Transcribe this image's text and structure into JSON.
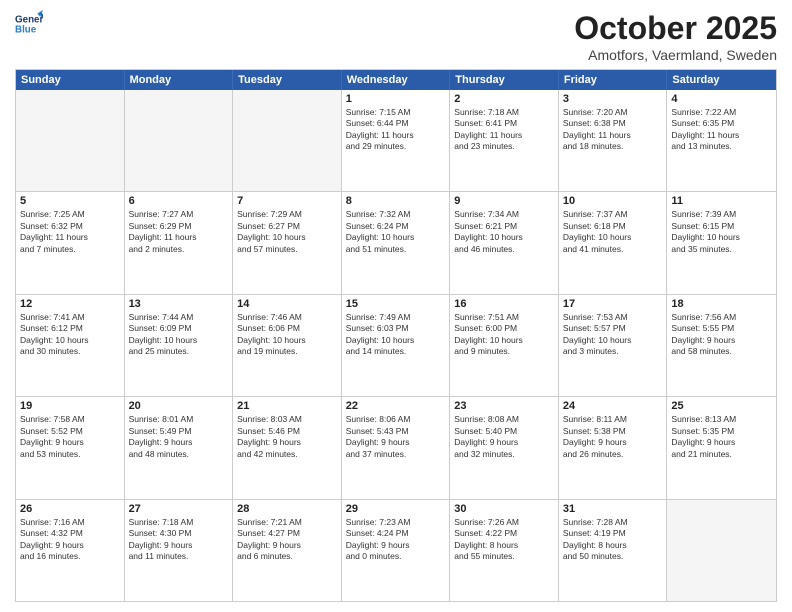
{
  "header": {
    "logo": {
      "line1": "General",
      "line2": "Blue"
    },
    "title": "October 2025",
    "location": "Amotfors, Vaermland, Sweden"
  },
  "weekdays": [
    "Sunday",
    "Monday",
    "Tuesday",
    "Wednesday",
    "Thursday",
    "Friday",
    "Saturday"
  ],
  "weeks": [
    [
      {
        "day": "",
        "text": ""
      },
      {
        "day": "",
        "text": ""
      },
      {
        "day": "",
        "text": ""
      },
      {
        "day": "1",
        "text": "Sunrise: 7:15 AM\nSunset: 6:44 PM\nDaylight: 11 hours\nand 29 minutes."
      },
      {
        "day": "2",
        "text": "Sunrise: 7:18 AM\nSunset: 6:41 PM\nDaylight: 11 hours\nand 23 minutes."
      },
      {
        "day": "3",
        "text": "Sunrise: 7:20 AM\nSunset: 6:38 PM\nDaylight: 11 hours\nand 18 minutes."
      },
      {
        "day": "4",
        "text": "Sunrise: 7:22 AM\nSunset: 6:35 PM\nDaylight: 11 hours\nand 13 minutes."
      }
    ],
    [
      {
        "day": "5",
        "text": "Sunrise: 7:25 AM\nSunset: 6:32 PM\nDaylight: 11 hours\nand 7 minutes."
      },
      {
        "day": "6",
        "text": "Sunrise: 7:27 AM\nSunset: 6:29 PM\nDaylight: 11 hours\nand 2 minutes."
      },
      {
        "day": "7",
        "text": "Sunrise: 7:29 AM\nSunset: 6:27 PM\nDaylight: 10 hours\nand 57 minutes."
      },
      {
        "day": "8",
        "text": "Sunrise: 7:32 AM\nSunset: 6:24 PM\nDaylight: 10 hours\nand 51 minutes."
      },
      {
        "day": "9",
        "text": "Sunrise: 7:34 AM\nSunset: 6:21 PM\nDaylight: 10 hours\nand 46 minutes."
      },
      {
        "day": "10",
        "text": "Sunrise: 7:37 AM\nSunset: 6:18 PM\nDaylight: 10 hours\nand 41 minutes."
      },
      {
        "day": "11",
        "text": "Sunrise: 7:39 AM\nSunset: 6:15 PM\nDaylight: 10 hours\nand 35 minutes."
      }
    ],
    [
      {
        "day": "12",
        "text": "Sunrise: 7:41 AM\nSunset: 6:12 PM\nDaylight: 10 hours\nand 30 minutes."
      },
      {
        "day": "13",
        "text": "Sunrise: 7:44 AM\nSunset: 6:09 PM\nDaylight: 10 hours\nand 25 minutes."
      },
      {
        "day": "14",
        "text": "Sunrise: 7:46 AM\nSunset: 6:06 PM\nDaylight: 10 hours\nand 19 minutes."
      },
      {
        "day": "15",
        "text": "Sunrise: 7:49 AM\nSunset: 6:03 PM\nDaylight: 10 hours\nand 14 minutes."
      },
      {
        "day": "16",
        "text": "Sunrise: 7:51 AM\nSunset: 6:00 PM\nDaylight: 10 hours\nand 9 minutes."
      },
      {
        "day": "17",
        "text": "Sunrise: 7:53 AM\nSunset: 5:57 PM\nDaylight: 10 hours\nand 3 minutes."
      },
      {
        "day": "18",
        "text": "Sunrise: 7:56 AM\nSunset: 5:55 PM\nDaylight: 9 hours\nand 58 minutes."
      }
    ],
    [
      {
        "day": "19",
        "text": "Sunrise: 7:58 AM\nSunset: 5:52 PM\nDaylight: 9 hours\nand 53 minutes."
      },
      {
        "day": "20",
        "text": "Sunrise: 8:01 AM\nSunset: 5:49 PM\nDaylight: 9 hours\nand 48 minutes."
      },
      {
        "day": "21",
        "text": "Sunrise: 8:03 AM\nSunset: 5:46 PM\nDaylight: 9 hours\nand 42 minutes."
      },
      {
        "day": "22",
        "text": "Sunrise: 8:06 AM\nSunset: 5:43 PM\nDaylight: 9 hours\nand 37 minutes."
      },
      {
        "day": "23",
        "text": "Sunrise: 8:08 AM\nSunset: 5:40 PM\nDaylight: 9 hours\nand 32 minutes."
      },
      {
        "day": "24",
        "text": "Sunrise: 8:11 AM\nSunset: 5:38 PM\nDaylight: 9 hours\nand 26 minutes."
      },
      {
        "day": "25",
        "text": "Sunrise: 8:13 AM\nSunset: 5:35 PM\nDaylight: 9 hours\nand 21 minutes."
      }
    ],
    [
      {
        "day": "26",
        "text": "Sunrise: 7:16 AM\nSunset: 4:32 PM\nDaylight: 9 hours\nand 16 minutes."
      },
      {
        "day": "27",
        "text": "Sunrise: 7:18 AM\nSunset: 4:30 PM\nDaylight: 9 hours\nand 11 minutes."
      },
      {
        "day": "28",
        "text": "Sunrise: 7:21 AM\nSunset: 4:27 PM\nDaylight: 9 hours\nand 6 minutes."
      },
      {
        "day": "29",
        "text": "Sunrise: 7:23 AM\nSunset: 4:24 PM\nDaylight: 9 hours\nand 0 minutes."
      },
      {
        "day": "30",
        "text": "Sunrise: 7:26 AM\nSunset: 4:22 PM\nDaylight: 8 hours\nand 55 minutes."
      },
      {
        "day": "31",
        "text": "Sunrise: 7:28 AM\nSunset: 4:19 PM\nDaylight: 8 hours\nand 50 minutes."
      },
      {
        "day": "",
        "text": ""
      }
    ]
  ]
}
